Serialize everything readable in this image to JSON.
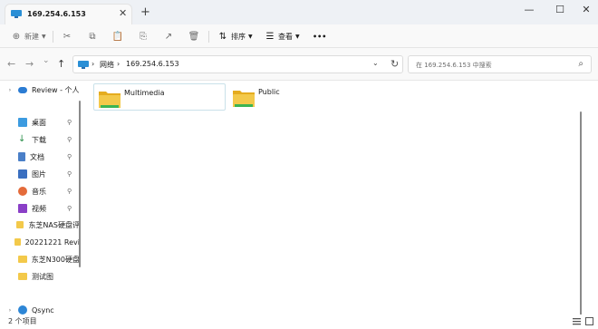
{
  "tab": {
    "title": "169.254.6.153",
    "close": "✕",
    "new": "+"
  },
  "window": {
    "minimize": "—",
    "maximize": "☐",
    "close": "✕"
  },
  "toolbar": {
    "new_label": "新建",
    "sort_label": "排序",
    "view_label": "查看",
    "more": "•••"
  },
  "nav": {
    "back": "←",
    "forward": "→",
    "recent": "⌄",
    "up": "↑"
  },
  "address": {
    "crumbs": [
      "网络",
      "169.254.6.153"
    ],
    "sep": "›",
    "dropdown": "⌄",
    "refresh": "↻"
  },
  "search": {
    "placeholder": "在 169.254.6.153 中搜索"
  },
  "sidebar": {
    "items": [
      {
        "label": "Review - 个人",
        "arrow": "›",
        "icon": "cloud-icon"
      },
      {
        "label": "桌面",
        "icon": "desktop-icon",
        "pinned": true
      },
      {
        "label": "下载",
        "icon": "download-icon",
        "pinned": true
      },
      {
        "label": "文档",
        "icon": "document-icon",
        "pinned": true
      },
      {
        "label": "图片",
        "icon": "pictures-icon",
        "pinned": true
      },
      {
        "label": "音乐",
        "icon": "music-icon",
        "pinned": true
      },
      {
        "label": "视频",
        "icon": "video-icon",
        "pinned": true
      },
      {
        "label": "东芝NAS硬盘评",
        "icon": "folder-icon"
      },
      {
        "label": "20221221 Revi",
        "icon": "folder-icon"
      },
      {
        "label": "东芝N300硬盘",
        "icon": "folder-icon"
      },
      {
        "label": "测试图",
        "icon": "folder-icon"
      },
      {
        "label": "Qsync",
        "arrow": "›",
        "icon": "qsync-icon"
      }
    ],
    "pin_glyph": "📌"
  },
  "folders": [
    {
      "name": "Multimedia",
      "selected": true
    },
    {
      "name": "Public",
      "selected": false
    }
  ],
  "status": {
    "count": "2 个项目"
  },
  "colors": {
    "accent": "#0067c0",
    "folder": "#f3c94a",
    "folder_back": "#e5ac1f",
    "folder_stripe": "#3cb452"
  }
}
